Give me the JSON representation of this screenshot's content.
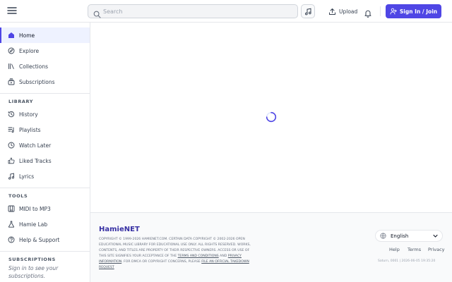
{
  "header": {
    "search_placeholder": "Search",
    "upload_label": "Upload",
    "signin_label": "Sign In / Join",
    "accent_color": "#4f46e5"
  },
  "sidebar": {
    "main": [
      {
        "label": "Home",
        "icon": "home-icon",
        "active": true
      },
      {
        "label": "Explore",
        "icon": "compass-icon"
      },
      {
        "label": "Collections",
        "icon": "library-icon"
      },
      {
        "label": "Subscriptions",
        "icon": "subscriptions-icon"
      }
    ],
    "library_title": "LIBRARY",
    "library": [
      {
        "label": "History",
        "icon": "history-icon"
      },
      {
        "label": "Playlists",
        "icon": "playlist-icon"
      },
      {
        "label": "Watch Later",
        "icon": "clock-icon"
      },
      {
        "label": "Liked Tracks",
        "icon": "thumbs-up-icon"
      },
      {
        "label": "Lyrics",
        "icon": "music-note-icon"
      }
    ],
    "tools_title": "TOOLS",
    "tools": [
      {
        "label": "MIDI to MP3",
        "icon": "midi-icon"
      },
      {
        "label": "Hamie Lab",
        "icon": "flask-icon"
      },
      {
        "label": "Help & Support",
        "icon": "help-icon"
      }
    ],
    "subscriptions_title": "SUBSCRIPTIONS",
    "subscriptions_note": "Sign in to see your subscriptions."
  },
  "footer": {
    "brand": "HamieNET",
    "legal_1": "COPYRIGHT © 1999-2026 HAMIENET.COM. CERTAIN DATA COPYRIGHT © 2002-2026 OPEN EDUCATIONAL MUSIC LIBRARY FOR EDUCATIONAL USE ONLY. ALL RIGHTS RESERVED. WORKS, CONTENTS, AND TITLES ARE PROPERTY OF THEIR RESPECTIVE OWNERS. ACCESS OR USE OF THIS SITE SIGNIFIES YOUR ACCEPTANCE OF THE ",
    "terms_link": "TERMS AND CONDITIONS",
    "legal_2": " AND ",
    "privacy_link": "PRIVACY INFORMATION",
    "legal_3": ". FOR DMCA OR COPYRIGHT CONCERNS, PLEASE ",
    "takedown_link": "FILE AN OFFICIAL TAKEDOWN REQUEST",
    "language": "English",
    "links": [
      "Help",
      "Terms",
      "Privacy"
    ],
    "build_info": "Saturn, 0001 | 2026-06-05 19:35:20"
  }
}
